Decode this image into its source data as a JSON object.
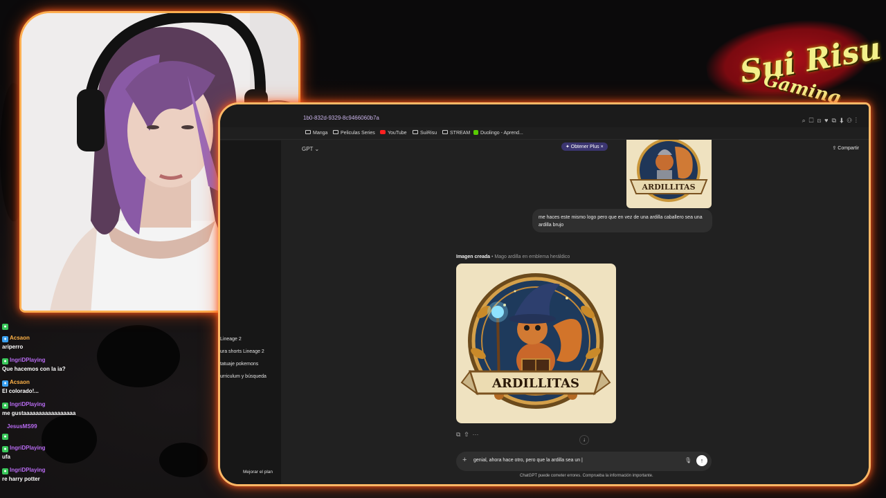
{
  "overlay": {
    "logo_line1": "Sui Risu",
    "logo_line2": "Gaming"
  },
  "chat": {
    "messages": [
      {
        "badge": "prime-icon",
        "user": "Acsaon",
        "user_color": "#ffb347",
        "text": "ariperro"
      },
      {
        "badge": "sub-icon",
        "user": "IngriDPlaying",
        "user_color": "#b86bf2",
        "text": "Que hacemos con la ia?"
      },
      {
        "badge": "prime-icon",
        "user": "Acsaon",
        "user_color": "#ffb347",
        "text": "El colorado!..."
      },
      {
        "badge": "sub-icon",
        "user": "IngriDPlaying",
        "user_color": "#b86bf2",
        "text": "me gustaaaaaaaaaaaaaaaaa"
      },
      {
        "badge": "",
        "user": "JesusMS99",
        "user_color": "#b86bf2",
        "text": ""
      },
      {
        "badge": "sub-icon",
        "user": "IngriDPlaying",
        "user_color": "#b86bf2",
        "text": "ufa"
      },
      {
        "badge": "sub-icon",
        "user": "IngriDPlaying",
        "user_color": "#b86bf2",
        "text": "re harry potter"
      }
    ]
  },
  "browser": {
    "url_fragment": "1b0-832d-9329-8c9466060b7a",
    "bookmarks": [
      "Manga",
      "Peliculas Series",
      "YouTube",
      "SuiRisu",
      "STREAM",
      "Duolingo - Aprend..."
    ],
    "sidebar_items": [
      "Lineage 2",
      "ura shorts Lineage 2",
      "tatuaje pokemons",
      "urriculum y búsqueda"
    ],
    "upgrade_label": "Mejorar el plan"
  },
  "chatgpt": {
    "model_label": "GPT ⌄",
    "plus_pill": "✦ Obtener Plus  ×",
    "share_label": "⇪ Compartir",
    "prev_emblem_text": "ARDILLITAS",
    "user_message": "me haces este mismo logo pero que en vez de una ardilla caballero sea una ardilla brujo",
    "image_caption_prefix": "Imagen creada",
    "image_caption_title": "Mago ardilla en emblema heráldico",
    "new_emblem_text": "ARDILLITAS",
    "composer_text": "genial, ahora hace otro, pero que la ardilla sea un |",
    "disclaimer": "ChatGPT puede cometer errores. Comprueba la información importante."
  }
}
